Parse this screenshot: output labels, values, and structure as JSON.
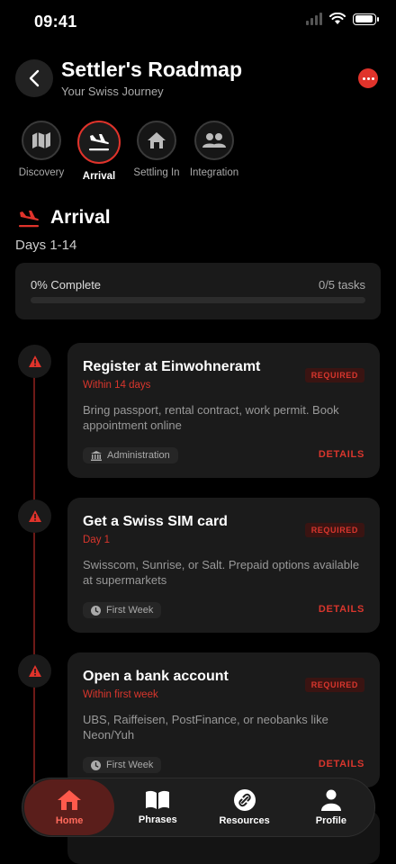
{
  "status_bar": {
    "time": "09:41"
  },
  "header": {
    "title": "Settler's Roadmap",
    "subtitle": "Your Swiss Journey"
  },
  "stages": [
    {
      "label": "Discovery",
      "icon": "map-icon"
    },
    {
      "label": "Arrival",
      "icon": "plane-landing-icon",
      "active": true
    },
    {
      "label": "Settling In",
      "icon": "house-icon"
    },
    {
      "label": "Integration",
      "icon": "people-icon"
    }
  ],
  "section": {
    "title": "Arrival",
    "days": "Days 1-14",
    "progress_text": "0% Complete",
    "tasks_count": "0/5 tasks",
    "progress_fraction": 0
  },
  "tasks": [
    {
      "title": "Register at Einwohneramt",
      "when": "Within 14 days",
      "badge": "REQUIRED",
      "description": "Bring passport, rental contract, work permit. Book appointment online",
      "category": "Administration",
      "category_icon": "building-icon",
      "details": "DETAILS"
    },
    {
      "title": "Get a Swiss SIM card",
      "when": "Day 1",
      "badge": "REQUIRED",
      "description": "Swisscom, Sunrise, or Salt. Prepaid options available at supermarkets",
      "category": "First Week",
      "category_icon": "clock-icon",
      "details": "DETAILS"
    },
    {
      "title": "Open a bank account",
      "when": "Within first week",
      "badge": "REQUIRED",
      "description": "UBS, Raiffeisen, PostFinance, or neobanks like Neon/Yuh",
      "category": "First Week",
      "category_icon": "clock-icon",
      "details": "DETAILS"
    }
  ],
  "bottom_nav": [
    {
      "label": "Home",
      "icon": "home-icon",
      "active": true
    },
    {
      "label": "Phrases",
      "icon": "book-icon"
    },
    {
      "label": "Resources",
      "icon": "link-icon"
    },
    {
      "label": "Profile",
      "icon": "person-icon"
    }
  ],
  "colors": {
    "accent": "#e0332b",
    "background": "#000000",
    "card": "#1b1b1b"
  }
}
